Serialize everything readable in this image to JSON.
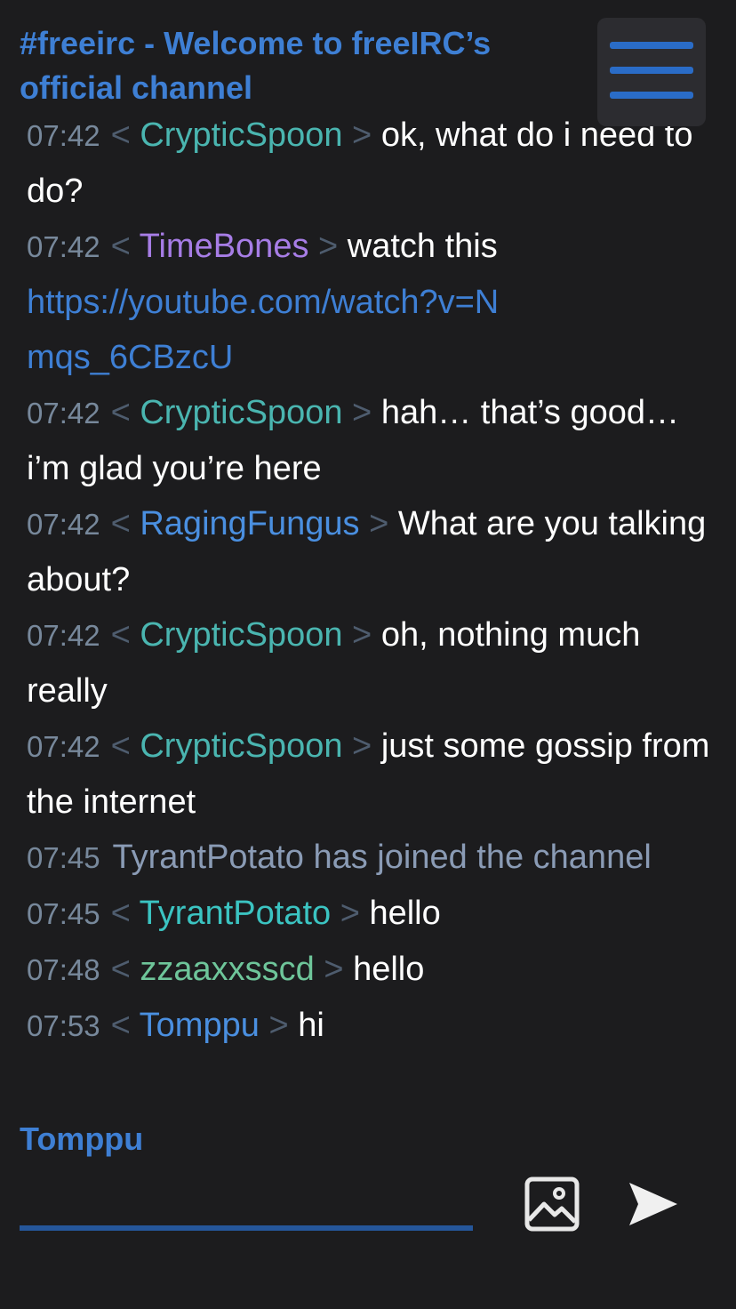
{
  "channel": {
    "title": "#freeirc - Welcome to freeIRC’s official channel"
  },
  "menu": {
    "icon": "hamburger-menu-icon",
    "color": "#2a6cc7"
  },
  "messages": [
    {
      "type": "chat",
      "time": "07:42",
      "nick": "CrypticSpoon",
      "text": "ok, what do i need to do?"
    },
    {
      "type": "chat",
      "time": "07:42",
      "nick": "TimeBones",
      "text": "watch this ",
      "link": "https://youtube.com/watch?v=Nmqs_6CBzcU"
    },
    {
      "type": "chat",
      "time": "07:42",
      "nick": "CrypticSpoon",
      "text": "hah… that’s good… i’m glad you’re here"
    },
    {
      "type": "chat",
      "time": "07:42",
      "nick": "RagingFungus",
      "text": "What are you talking about?"
    },
    {
      "type": "chat",
      "time": "07:42",
      "nick": "CrypticSpoon",
      "text": "oh, nothing much really"
    },
    {
      "type": "chat",
      "time": "07:42",
      "nick": "CrypticSpoon",
      "text": "just some gossip from the internet"
    },
    {
      "type": "system",
      "time": "07:45",
      "text": "TyrantPotato has joined the channel"
    },
    {
      "type": "chat",
      "time": "07:45",
      "nick": "TyrantPotato",
      "text": "hello"
    },
    {
      "type": "chat",
      "time": "07:48",
      "nick": "zzaaxxsscd",
      "text": "hello"
    },
    {
      "type": "chat",
      "time": "07:53",
      "nick": "Tomppu",
      "text": "hi"
    }
  ],
  "brackets": {
    "open": "<",
    "close": ">"
  },
  "composer": {
    "nickname": "Tomppu",
    "input_value": "",
    "input_placeholder": "",
    "image_icon": "image-icon",
    "send_icon": "send-icon"
  },
  "colors": {
    "background": "#1c1c1e",
    "accent": "#3e7fd4",
    "timestamp": "#77889b",
    "nick_CrypticSpoon": "#4ab5b0",
    "nick_TimeBones": "#a77de6",
    "nick_RagingFungus": "#4a8fe0",
    "nick_TyrantPotato": "#3bc4c2",
    "nick_zzaaxxsscd": "#6ec59a",
    "nick_Tomppu": "#4a8fe0"
  }
}
